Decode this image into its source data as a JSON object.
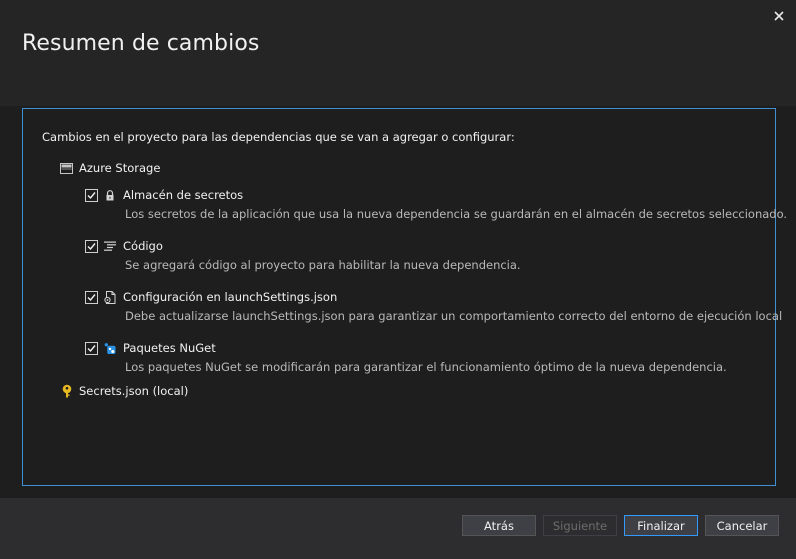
{
  "dialog": {
    "title": "Resumen de cambios"
  },
  "panel": {
    "intro": "Cambios en el proyecto para las dependencias que se van a agregar o configurar:",
    "group": {
      "label": "Azure Storage",
      "icon": "storage-icon"
    },
    "items": [
      {
        "label": "Almacén de secretos",
        "desc": "Los secretos de la aplicación que usa la nueva dependencia se guardarán en el almacén de secretos seleccionado.",
        "checked": true,
        "icon": "lock-icon"
      },
      {
        "label": "Código",
        "desc": "Se agregará código al proyecto para habilitar la nueva dependencia.",
        "checked": true,
        "icon": "code-icon"
      },
      {
        "label": "Configuración en launchSettings.json",
        "desc": "Debe actualizarse launchSettings.json para garantizar un comportamiento correcto del entorno de ejecución local",
        "checked": true,
        "icon": "settings-file-icon"
      },
      {
        "label": "Paquetes NuGet",
        "desc": "Los paquetes NuGet se modificarán para garantizar el funcionamiento óptimo de la nueva dependencia.",
        "checked": true,
        "icon": "nuget-icon"
      }
    ],
    "secrets": {
      "label": "Secrets.json (local)",
      "icon": "key-icon"
    }
  },
  "footer": {
    "back": "Atrás",
    "next": "Siguiente",
    "finish": "Finalizar",
    "cancel": "Cancelar"
  },
  "colors": {
    "accent": "#3f8fd2",
    "background": "#1e1e1e",
    "chrome": "#252526"
  }
}
